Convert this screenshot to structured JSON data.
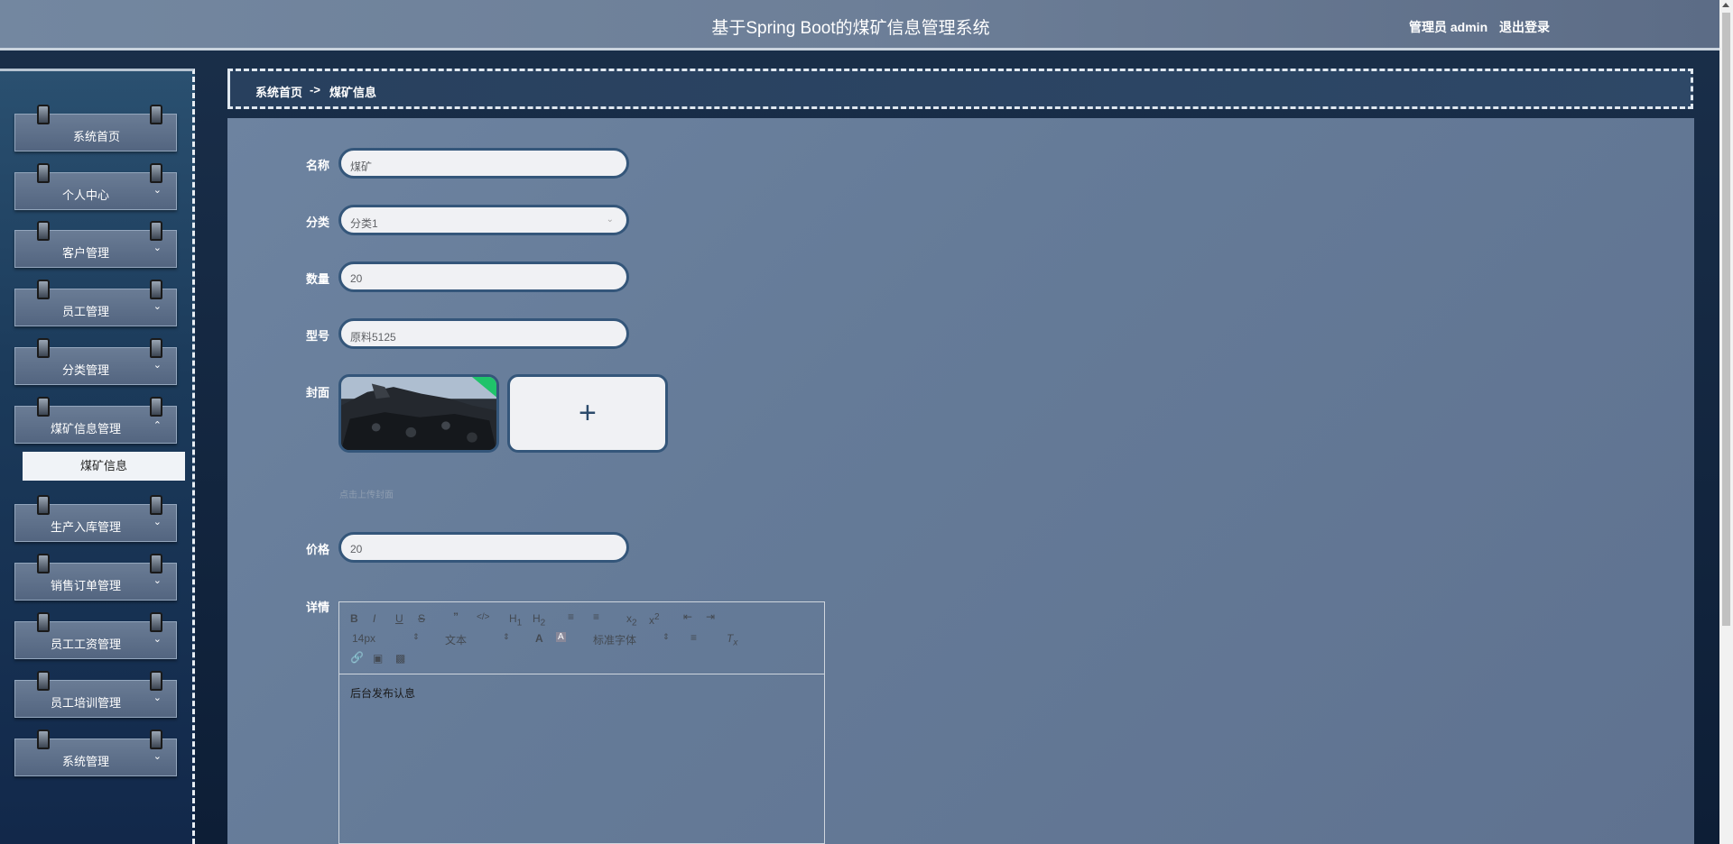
{
  "header": {
    "title": "基于Spring Boot的煤矿信息管理系统",
    "user": "管理员 admin",
    "logout": "退出登录"
  },
  "sidebar": {
    "items": [
      {
        "label": "系统首页",
        "expandable": false
      },
      {
        "label": "个人中心",
        "expandable": true
      },
      {
        "label": "客户管理",
        "expandable": true
      },
      {
        "label": "员工管理",
        "expandable": true
      },
      {
        "label": "分类管理",
        "expandable": true
      },
      {
        "label": "煤矿信息管理",
        "expandable": true,
        "expanded": true
      },
      {
        "label": "生产入库管理",
        "expandable": true
      },
      {
        "label": "销售订单管理",
        "expandable": true
      },
      {
        "label": "员工工资管理",
        "expandable": true
      },
      {
        "label": "员工培训管理",
        "expandable": true
      },
      {
        "label": "系统管理",
        "expandable": true
      }
    ],
    "subitem": "煤矿信息"
  },
  "breadcrumb": {
    "home": "系统首页",
    "separator": "->",
    "current": "煤矿信息"
  },
  "form": {
    "name_label": "名称",
    "name_value": "煤矿",
    "category_label": "分类",
    "category_value": "分类1",
    "quantity_label": "数量",
    "quantity_value": "20",
    "model_label": "型号",
    "model_value": "原料5125",
    "cover_label": "封面",
    "cover_tip": "点击上传封面",
    "price_label": "价格",
    "price_value": "20",
    "detail_label": "详情",
    "detail_content": "后台发布认息"
  },
  "editor": {
    "font_size": "14px",
    "paragraph": "文本",
    "font_family": "标准字体"
  },
  "colors": {
    "header_bg": "#6d7f98",
    "panel_bg": "#657b98",
    "input_border": "#34567a",
    "submenu_bg": "#f0f3f7"
  }
}
